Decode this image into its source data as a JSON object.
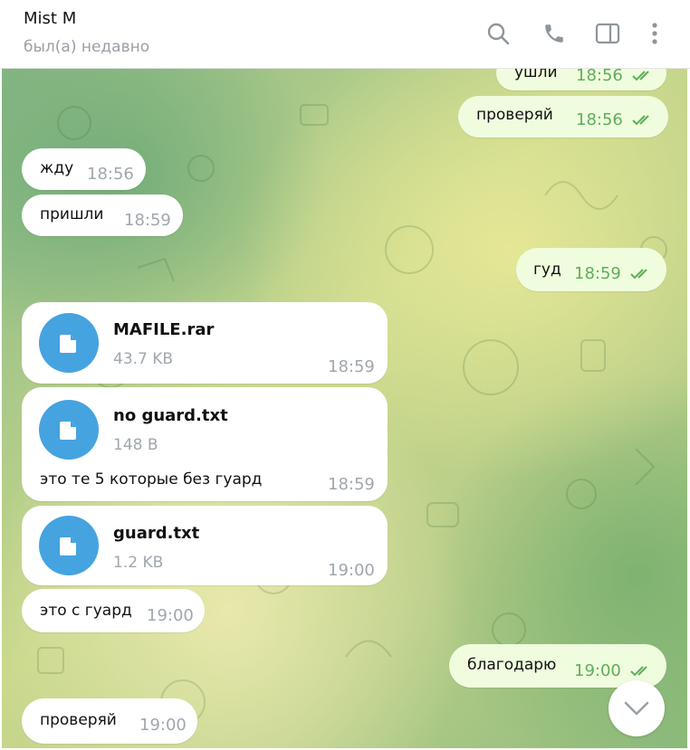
{
  "header": {
    "title": "Mist M",
    "status": "был(а) недавно",
    "icons": [
      "search-icon",
      "phone-icon",
      "sidebar-toggle-icon",
      "more-vertical-icon"
    ]
  },
  "colors": {
    "accent": "#45a3e0",
    "outgoing_bubble": "#effdde",
    "incoming_bubble": "#ffffff",
    "outgoing_time": "#5fad5b",
    "incoming_time": "#a0a7ad"
  },
  "messages": [
    {
      "dir": "out",
      "text": "ушли",
      "time": "18:56",
      "read": true
    },
    {
      "dir": "out",
      "text": "проверяй",
      "time": "18:56",
      "read": true
    },
    {
      "dir": "in",
      "text": "жду",
      "time": "18:56"
    },
    {
      "dir": "in",
      "text": "пришли",
      "time": "18:59"
    },
    {
      "dir": "out",
      "text": "гуд",
      "time": "18:59",
      "read": true
    },
    {
      "dir": "in",
      "file_name": "MAFILE.rar",
      "file_size": "43.7 KB",
      "time": "18:59"
    },
    {
      "dir": "in",
      "file_name": "no guard.txt",
      "file_size": "148 B",
      "caption": "это те 5 которые без гуард",
      "time": "18:59"
    },
    {
      "dir": "in",
      "file_name": "guard.txt",
      "file_size": "1.2 KB",
      "time": "19:00"
    },
    {
      "dir": "in",
      "text": "это с гуард",
      "time": "19:00"
    },
    {
      "dir": "out",
      "text": "благодарю",
      "time": "19:00",
      "read": true
    },
    {
      "dir": "in",
      "text": "проверяй",
      "time": "19:00"
    }
  ]
}
